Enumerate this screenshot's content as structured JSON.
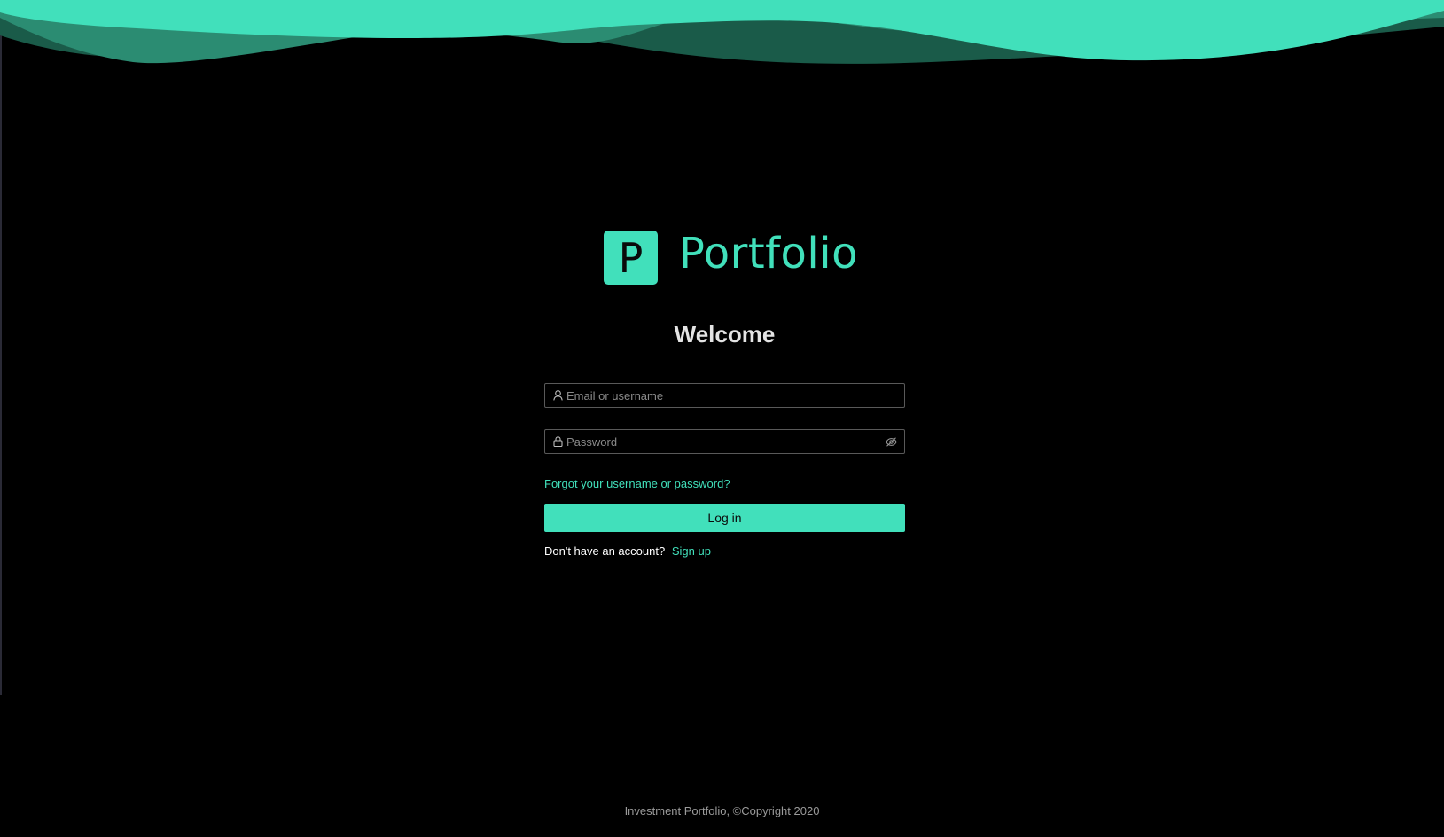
{
  "colors": {
    "accent": "#41e0bb",
    "wave_mid": "#2b8c72",
    "wave_dark": "#1a5b49",
    "background": "#000000"
  },
  "brand": {
    "logo_letter": "P",
    "name": "Portfolio"
  },
  "heading": "Welcome",
  "form": {
    "username_placeholder": "Email or username",
    "username_icon": "user-icon",
    "password_placeholder": "Password",
    "password_icon": "lock-icon",
    "password_toggle_icon": "eye-off-icon",
    "forgot_link": "Forgot your username or password?",
    "login_button": "Log in",
    "signup_prompt": "Don't have an account?",
    "signup_link": "Sign up"
  },
  "footer": {
    "text": "Investment Portfolio, ©Copyright 2020"
  }
}
